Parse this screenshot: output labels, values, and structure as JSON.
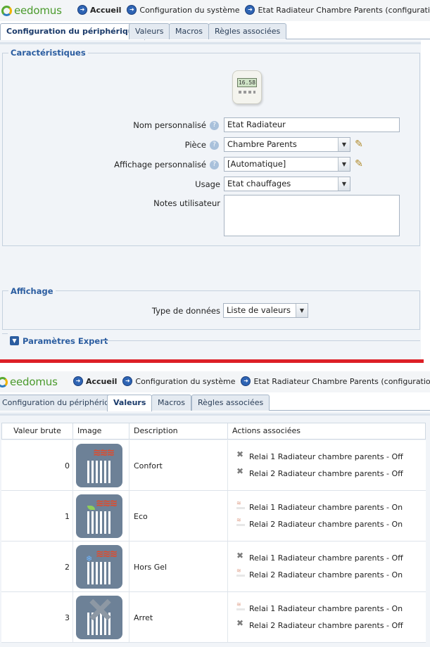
{
  "top": {
    "logo": "eedomus",
    "nav": [
      "Accueil",
      "Configuration du système",
      "Etat Radiateur Chambre Parents (configuration)"
    ]
  },
  "tabs": [
    "Configuration du périphérique",
    "Valeurs",
    "Macros",
    "Règles associées"
  ],
  "config": {
    "section_caracteristiques": "Caractéristiques",
    "device_screen": "16.58",
    "fields": {
      "nom_label": "Nom personnalisé",
      "nom_value": "Etat Radiateur",
      "piece_label": "Pièce",
      "piece_value": "Chambre Parents",
      "affichage_label": "Affichage personnalisé",
      "affichage_value": "[Automatique]",
      "usage_label": "Usage",
      "usage_value": "Etat chauffages",
      "notes_label": "Notes utilisateur"
    },
    "section_affichage": "Affichage",
    "type_label": "Type de données",
    "type_value": "Liste de valeurs",
    "expert_label": "Paramètres Expert"
  },
  "values_table": {
    "headers": [
      "Valeur brute",
      "Image",
      "Description",
      "Actions associées"
    ],
    "rows": [
      {
        "raw": "0",
        "description": "Confort",
        "actions": [
          {
            "text": "Relai 1 Radiateur chambre parents - Off",
            "icon": "x-icon"
          },
          {
            "text": "Relai 2 Radiateur chambre parents - Off",
            "icon": "x-icon"
          }
        ]
      },
      {
        "raw": "1",
        "description": "Eco",
        "actions": [
          {
            "text": "Relai 1 Radiateur chambre parents - On",
            "icon": "heat-icon"
          },
          {
            "text": "Relai 2 Radiateur chambre parents - On",
            "icon": "heat-icon"
          }
        ]
      },
      {
        "raw": "2",
        "description": "Hors Gel",
        "actions": [
          {
            "text": "Relai 1 Radiateur chambre parents - Off",
            "icon": "x-icon"
          },
          {
            "text": "Relai 2 Radiateur chambre parents - On",
            "icon": "heat-icon"
          }
        ]
      },
      {
        "raw": "3",
        "description": "Arret",
        "actions": [
          {
            "text": "Relai 1 Radiateur chambre parents - On",
            "icon": "heat-icon"
          },
          {
            "text": "Relai 2 Radiateur chambre parents - Off",
            "icon": "x-icon"
          }
        ]
      }
    ]
  },
  "colors": {
    "accent": "#2b5da0",
    "logo_green": "#4a9a2c",
    "separator_red": "#dd1f26"
  }
}
